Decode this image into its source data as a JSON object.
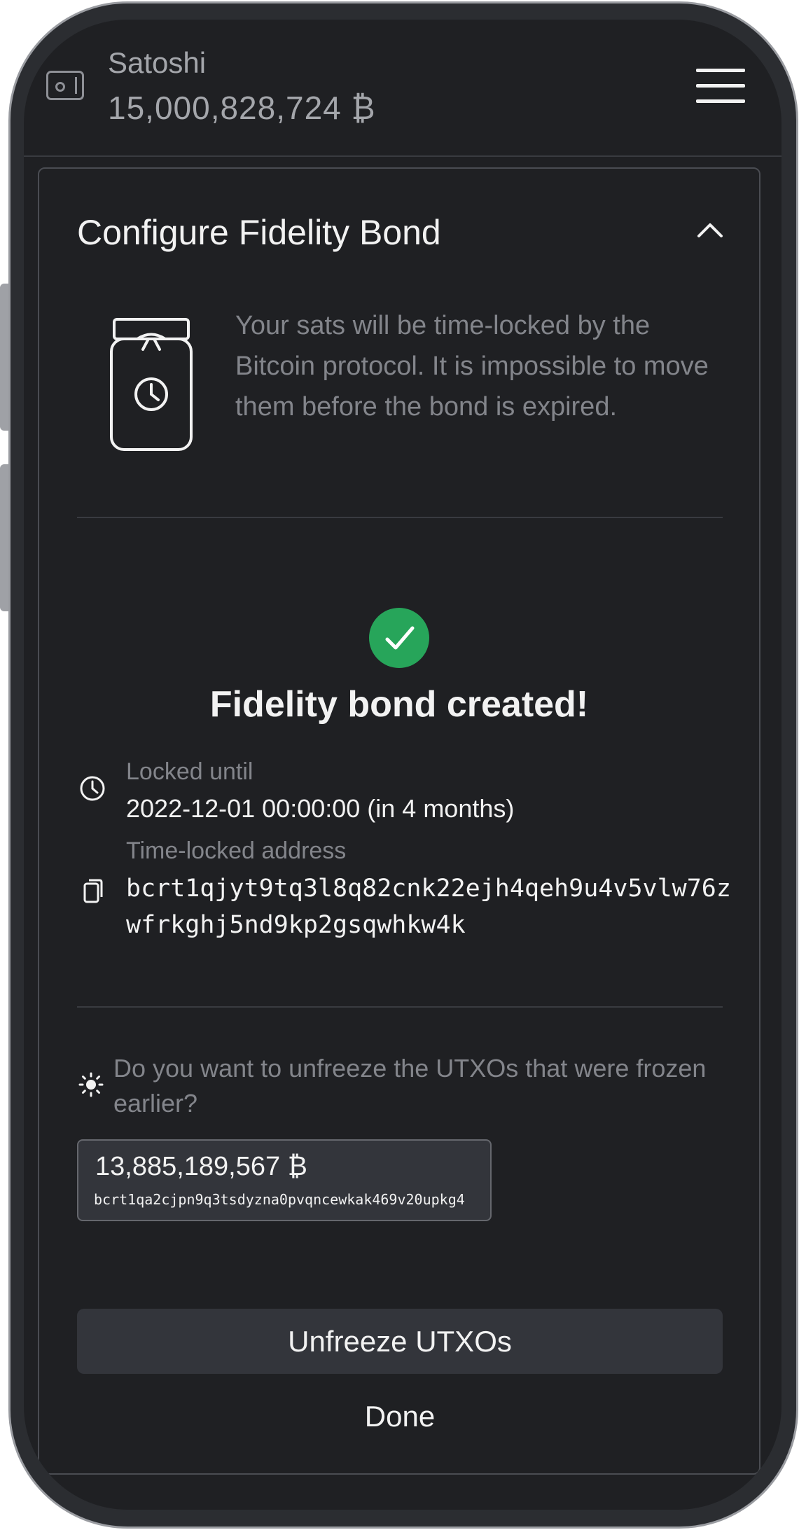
{
  "header": {
    "wallet_name": "Satoshi",
    "wallet_balance": "15,000,828,724 ₿"
  },
  "card": {
    "title": "Configure Fidelity Bond",
    "intro_text": "Your sats will be time-locked by the Bitcoin protocol. It is impossible to move them before the bond is expired.",
    "success_title": "Fidelity bond created!",
    "locked_until_label": "Locked until",
    "locked_until_value": "2022-12-01 00:00:00 (in 4 months)",
    "address_label": "Time-locked address",
    "address_value": "bcrt1qjyt9tq3l8q82cnk22ejh4qeh9u4v5vlw76zwfrkghj5nd9kp2gsqwhkw4k",
    "unfreeze_question": "Do you want to unfreeze the UTXOs that were frozen earlier?",
    "utxo": {
      "amount": "13,885,189,567 ₿",
      "address": "bcrt1qa2cjpn9q3tsdyzna0pvqncewkak469v20upkg4"
    },
    "unfreeze_button": "Unfreeze UTXOs",
    "done_button": "Done"
  },
  "colors": {
    "background": "#1f2023",
    "success": "#27a55a",
    "muted_text": "#83858b",
    "surface": "#33353b"
  },
  "icons": {
    "wallet": "wallet-icon",
    "menu": "hamburger-menu-icon",
    "collapse": "chevron-up-icon",
    "jar": "time-locked-jar-icon",
    "success": "checkmark-icon",
    "clock": "clock-icon",
    "copy": "copy-icon",
    "sun": "sun-icon"
  }
}
